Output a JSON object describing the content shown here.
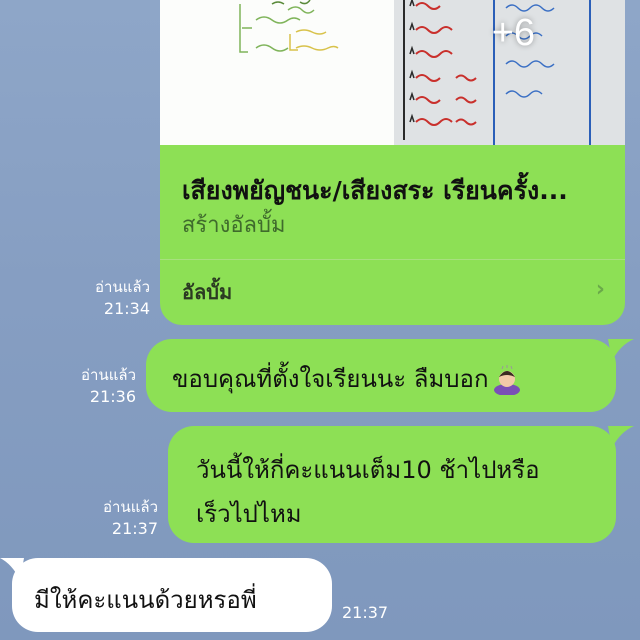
{
  "album": {
    "more_count": "+6",
    "title": "เสียงพยัญชนะ/เสียงสระ เรียนครั้ง...",
    "subtitle": "สร้างอัลบั้ม",
    "link_label": "อัลบั้ม"
  },
  "messages": [
    {
      "read": "อ่านแล้ว",
      "time": "21:34"
    },
    {
      "read": "อ่านแล้ว",
      "time": "21:36",
      "text": "ขอบคุณที่ตั้งใจเรียนนะ ลืมบอก"
    },
    {
      "read": "อ่านแล้ว",
      "time": "21:37",
      "line1": "วันนี้ให้กี่คะแนนเต็ม10 ช้าไปหรือ",
      "line2": "เร็วไปไหม"
    },
    {
      "time": "21:37",
      "text": "มีให้คะแนนด้วยหรอพี่"
    }
  ],
  "colors": {
    "outgoing_bubble": "#8de055",
    "incoming_bubble": "#ffffff",
    "background": "#8ea6c8"
  },
  "icons": {
    "album_link": "chevron-right-icon",
    "emoji": "person-bowing-emoji"
  }
}
